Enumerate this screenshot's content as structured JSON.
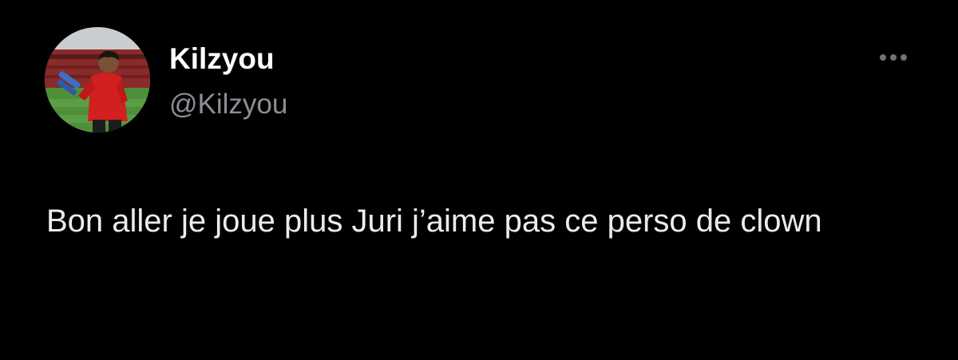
{
  "user": {
    "display_name": "Kilzyou",
    "handle": "@Kilzyou",
    "avatar_icon": "profile-photo"
  },
  "menu": {
    "more_icon": "ellipsis-icon"
  },
  "tweet": {
    "text": "Bon aller je joue plus Juri j’aime pas ce perso de clown"
  },
  "colors": {
    "background": "#000000",
    "name": "#ffffff",
    "handle": "#8b8f94",
    "text": "#ececec",
    "more_dots": "#6e7378"
  }
}
